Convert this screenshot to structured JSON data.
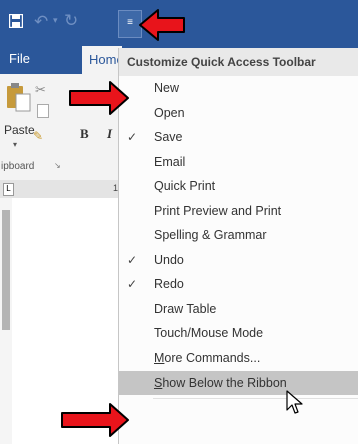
{
  "quick_access": {
    "save_icon": "save-icon",
    "undo_icon": "undo-icon",
    "redo_icon": "redo-icon",
    "dropdown_glyph": "≡"
  },
  "tabs": {
    "file": "File",
    "home": "Home"
  },
  "ribbon": {
    "paste_label": "Paste",
    "bold": "B",
    "italic": "I",
    "group_label": "ipboard",
    "ruler_number": "1"
  },
  "menu": {
    "title": "Customize Quick Access Toolbar",
    "items": [
      {
        "label": "New",
        "checked": false
      },
      {
        "label": "Open",
        "checked": false
      },
      {
        "label": "Save",
        "checked": true
      },
      {
        "label": "Email",
        "checked": false
      },
      {
        "label": "Quick Print",
        "checked": false
      },
      {
        "label": "Print Preview and Print",
        "checked": false
      },
      {
        "label": "Spelling & Grammar",
        "checked": false
      },
      {
        "label": "Undo",
        "checked": true
      },
      {
        "label": "Redo",
        "checked": true
      },
      {
        "label": "Draw Table",
        "checked": false
      },
      {
        "label": "Touch/Mouse Mode",
        "checked": false
      },
      {
        "label": "More Commands...",
        "checked": false
      },
      {
        "label": "Show Below the Ribbon",
        "checked": false,
        "highlighted": true
      }
    ],
    "check_glyph": "✓"
  },
  "colors": {
    "title_bar": "#2b579a",
    "arrow_fill": "#e8141b",
    "menu_highlight": "#c5c5c5"
  }
}
